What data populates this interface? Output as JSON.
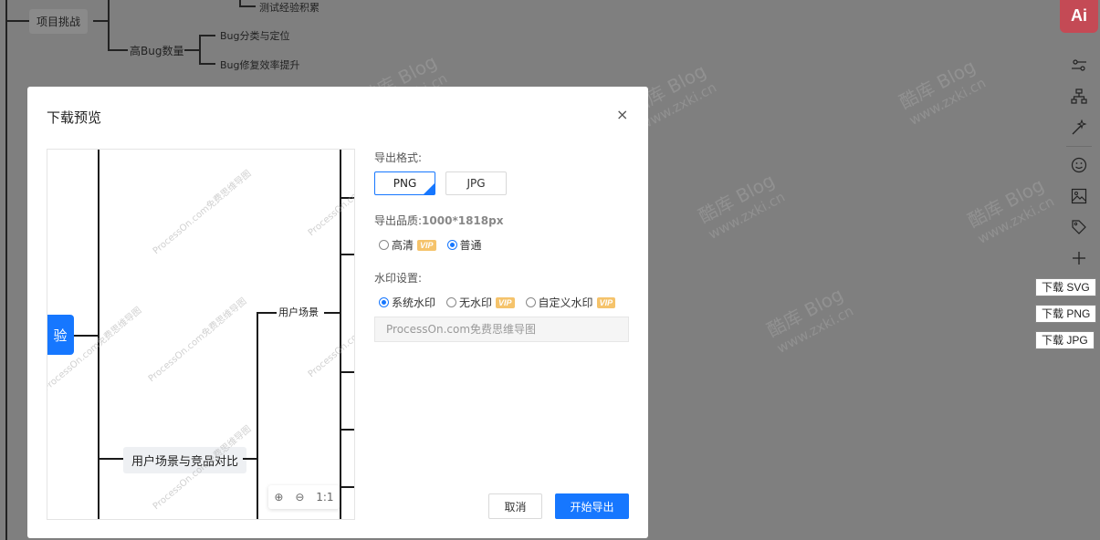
{
  "canvas": {
    "nodes": {
      "challenge": "项目挑战",
      "test_exp": "测试经验积累",
      "high_bug": "高Bug数量",
      "bug_classify": "Bug分类与定位",
      "bug_fix": "Bug修复效率提升"
    },
    "watermark_brand": "酷库 Blog",
    "watermark_url": "www.zxki.cn"
  },
  "toolbar": {
    "ai_label": "Ai",
    "tools": [
      "settings-sliders-icon",
      "org-chart-icon",
      "magic-wand-icon",
      "emoji-icon",
      "image-icon",
      "tag-icon",
      "plus-icon"
    ],
    "download_svg": "下载 SVG",
    "download_png": "下载 PNG",
    "download_jpg": "下载 JPG"
  },
  "modal": {
    "title": "下载预览",
    "close": "×",
    "preview": {
      "root_label": "验",
      "node_scene": "用户场景",
      "node_compare": "用户场景与竞品对比",
      "watermark": "ProcessOn.com免费思维导图",
      "zoom_in": "⊕",
      "zoom_out": "⊖",
      "zoom_reset": "1:1"
    },
    "format_label": "导出格式:",
    "formats": {
      "png": "PNG",
      "jpg": "JPG",
      "selected": "PNG"
    },
    "quality_label": "导出品质:",
    "quality_size": "1000*1818px",
    "quality_options": {
      "hd": "高清",
      "normal": "普通",
      "selected": "普通"
    },
    "vip": "VIP",
    "watermark_label": "水印设置:",
    "watermark_options": {
      "system": "系统水印",
      "none": "无水印",
      "custom": "自定义水印",
      "selected": "系统水印"
    },
    "watermark_text": "ProcessOn.com免费思维导图",
    "cancel": "取消",
    "export": "开始导出"
  }
}
